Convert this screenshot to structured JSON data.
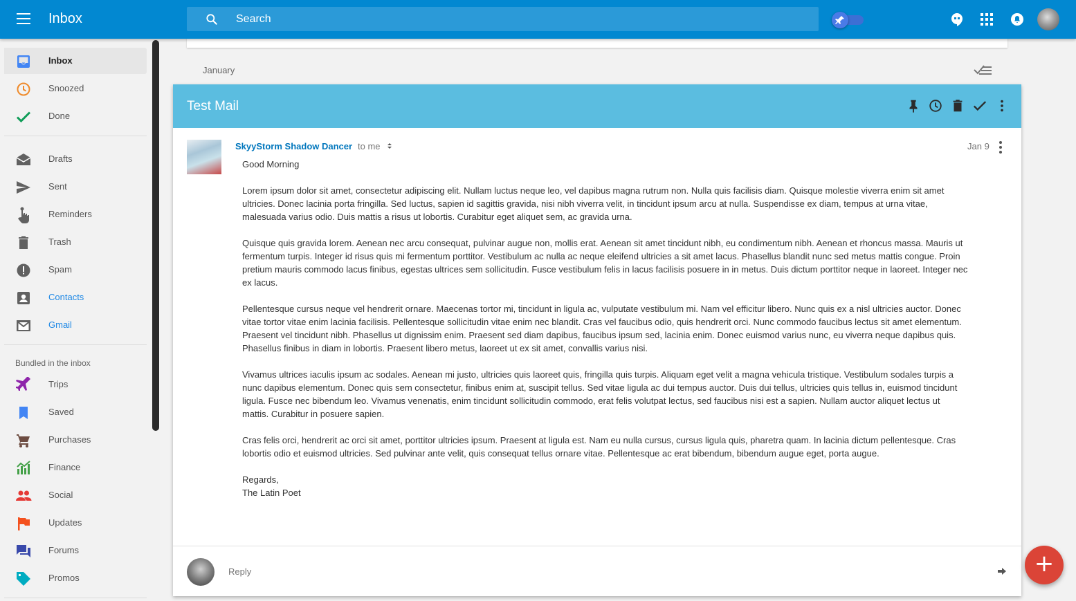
{
  "app": {
    "title": "Inbox"
  },
  "search": {
    "placeholder": "Search"
  },
  "sidebar": {
    "primary": [
      {
        "label": "Inbox",
        "icon": "inbox-icon",
        "active": true
      },
      {
        "label": "Snoozed",
        "icon": "clock-icon"
      },
      {
        "label": "Done",
        "icon": "check-icon"
      }
    ],
    "secondary": [
      {
        "label": "Drafts",
        "icon": "drafts-icon"
      },
      {
        "label": "Sent",
        "icon": "send-icon"
      },
      {
        "label": "Reminders",
        "icon": "reminder-hand-icon"
      },
      {
        "label": "Trash",
        "icon": "trash-icon"
      },
      {
        "label": "Spam",
        "icon": "spam-icon"
      },
      {
        "label": "Contacts",
        "icon": "contacts-icon"
      },
      {
        "label": "Gmail",
        "icon": "gmail-icon"
      }
    ],
    "bundled_label": "Bundled in the inbox",
    "bundles": [
      {
        "label": "Trips",
        "icon": "plane-icon",
        "color": "#8e24aa"
      },
      {
        "label": "Saved",
        "icon": "bookmark-icon",
        "color": "#4285f4"
      },
      {
        "label": "Purchases",
        "icon": "cart-icon",
        "color": "#6d4c41"
      },
      {
        "label": "Finance",
        "icon": "finance-icon",
        "color": "#43a047"
      },
      {
        "label": "Social",
        "icon": "people-icon",
        "color": "#e53935"
      },
      {
        "label": "Updates",
        "icon": "flag-icon",
        "color": "#f4511e"
      },
      {
        "label": "Forums",
        "icon": "forum-icon",
        "color": "#3949ab"
      },
      {
        "label": "Promos",
        "icon": "tag-icon",
        "color": "#00acc1"
      }
    ]
  },
  "main": {
    "month": "January",
    "mail": {
      "subject": "Test Mail",
      "sender": "SkyyStorm Shadow Dancer",
      "to": "to me",
      "date": "Jan 9",
      "greeting": "Good Morning",
      "paragraphs": [
        "Lorem ipsum dolor sit amet, consectetur adipiscing elit. Nullam luctus neque leo, vel dapibus magna rutrum non. Nulla quis facilisis diam. Quisque molestie viverra enim sit amet ultricies. Donec lacinia porta fringilla. Sed luctus, sapien id sagittis gravida, nisi nibh viverra velit, in tincidunt ipsum arcu at nulla. Suspendisse ex diam, tempus at urna vitae, malesuada varius odio. Duis mattis a risus ut lobortis. Curabitur eget aliquet sem, ac gravida urna.",
        "Quisque quis gravida lorem. Aenean nec arcu consequat, pulvinar augue non, mollis erat. Aenean sit amet tincidunt nibh, eu condimentum nibh. Aenean et rhoncus massa. Mauris ut fermentum turpis. Integer id risus quis mi fermentum porttitor. Vestibulum ac nulla ac neque eleifend ultricies a sit amet lacus. Phasellus blandit nunc sed metus mattis congue. Proin pretium mauris commodo lacus finibus, egestas ultrices sem sollicitudin. Fusce vestibulum felis in lacus facilisis posuere in in metus. Duis dictum porttitor neque in laoreet. Integer nec ex lacus.",
        "Pellentesque cursus neque vel hendrerit ornare. Maecenas tortor mi, tincidunt in ligula ac, vulputate vestibulum mi. Nam vel efficitur libero. Nunc quis ex a nisl ultricies auctor. Donec vitae tortor vitae enim lacinia facilisis. Pellentesque sollicitudin vitae enim nec blandit. Cras vel faucibus odio, quis hendrerit orci. Nunc commodo faucibus lectus sit amet elementum. Praesent vel tincidunt nibh. Phasellus ut dignissim enim. Praesent sed diam dapibus, faucibus ipsum sed, lacinia enim. Donec euismod varius nunc, eu viverra neque dapibus quis. Phasellus finibus in diam in lobortis. Praesent libero metus, laoreet ut ex sit amet, convallis varius nisi.",
        "Vivamus ultrices iaculis ipsum ac sodales. Aenean mi justo, ultricies quis laoreet quis, fringilla quis turpis. Aliquam eget velit a magna vehicula tristique. Vestibulum sodales turpis a nunc dapibus elementum. Donec quis sem consectetur, finibus enim at, suscipit tellus. Sed vitae ligula ac dui tempus auctor. Duis dui tellus, ultricies quis tellus in, euismod tincidunt ligula. Fusce nec bibendum leo. Vivamus venenatis, enim tincidunt sollicitudin commodo, erat felis volutpat lectus, sed faucibus nisi est a sapien. Nullam auctor aliquet lectus ut mattis. Curabitur in posuere sapien.",
        "Cras felis orci, hendrerit ac orci sit amet, porttitor ultricies ipsum. Praesent at ligula est. Nam eu nulla cursus, cursus ligula quis, pharetra quam. In lacinia dictum pellentesque. Cras lobortis odio et euismod ultricies. Sed pulvinar ante velit, quis consequat tellus ornare vitae. Pellentesque ac erat bibendum, bibendum augue eget, porta augue."
      ],
      "signoff": "Regards,",
      "signature": "The Latin Poet"
    },
    "reply_label": "Reply"
  },
  "colors": {
    "topbar": "#0288d1",
    "mail_header": "#5bbde0",
    "fab": "#db4437",
    "sender": "#0277bd"
  }
}
